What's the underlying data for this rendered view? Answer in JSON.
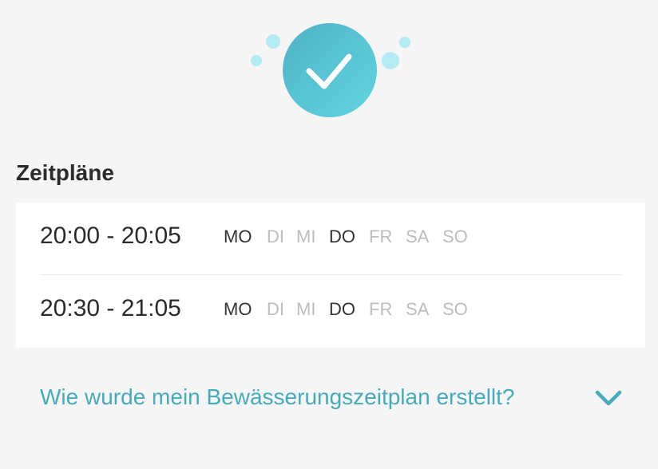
{
  "hero": {
    "icon": "checkmark-icon",
    "circle_color": "#58c6d5",
    "bubble_color": "#b4ebf2"
  },
  "schedules": {
    "title": "Zeitpläne",
    "items": [
      {
        "time": "20:00 - 20:05",
        "days": [
          {
            "label": "MO",
            "active": true
          },
          {
            "label": "DI",
            "active": false
          },
          {
            "label": "MI",
            "active": false
          },
          {
            "label": "DO",
            "active": true
          },
          {
            "label": "FR",
            "active": false
          },
          {
            "label": "SA",
            "active": false
          },
          {
            "label": "SO",
            "active": false
          }
        ]
      },
      {
        "time": "20:30 - 21:05",
        "days": [
          {
            "label": "MO",
            "active": true
          },
          {
            "label": "DI",
            "active": false
          },
          {
            "label": "MI",
            "active": false
          },
          {
            "label": "DO",
            "active": true
          },
          {
            "label": "FR",
            "active": false
          },
          {
            "label": "SA",
            "active": false
          },
          {
            "label": "SO",
            "active": false
          }
        ]
      }
    ]
  },
  "faq": {
    "question": "Wie wurde mein Bewässerungszeitplan erstellt?",
    "icon": "chevron-down-icon",
    "link_color": "#45abbc"
  }
}
